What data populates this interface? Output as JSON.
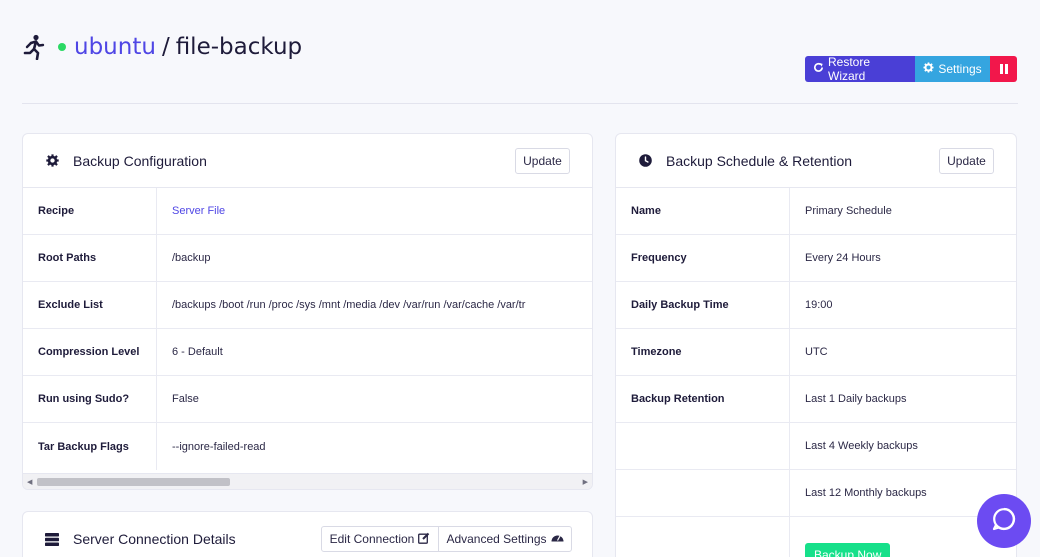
{
  "header": {
    "server": "ubuntu",
    "separator": "/",
    "app": "file-backup",
    "status_color": "#2bd964"
  },
  "actions": {
    "restore_wizard": "Restore Wizard",
    "settings": "Settings"
  },
  "backup_config": {
    "title": "Backup Configuration",
    "update": "Update",
    "rows": [
      {
        "label": "Recipe",
        "value": "Server File"
      },
      {
        "label": "Root Paths",
        "value": "/backup"
      },
      {
        "label": "Exclude List",
        "value": "/backups /boot /run /proc /sys /mnt /media /dev /var/run /var/cache /var/tr"
      },
      {
        "label": "Compression Level",
        "value": "6 - Default"
      },
      {
        "label": "Run using Sudo?",
        "value": "False"
      },
      {
        "label": "Tar Backup Flags",
        "value": "--ignore-failed-read"
      }
    ]
  },
  "schedule": {
    "title": "Backup Schedule & Retention",
    "update": "Update",
    "rows": [
      {
        "label": "Name",
        "value": "Primary Schedule"
      },
      {
        "label": "Frequency",
        "value": "Every 24 Hours"
      },
      {
        "label": "Daily Backup Time",
        "value": "19:00"
      },
      {
        "label": "Timezone",
        "value": "UTC"
      },
      {
        "label": "Backup Retention",
        "value": "Last 1 Daily backups"
      },
      {
        "label": "",
        "value": "Last 4 Weekly backups"
      },
      {
        "label": "",
        "value": "Last 12 Monthly backups"
      }
    ],
    "backup_now": "Backup Now"
  },
  "server_connection": {
    "title": "Server Connection Details",
    "edit": "Edit Connection",
    "advanced": "Advanced Settings"
  }
}
